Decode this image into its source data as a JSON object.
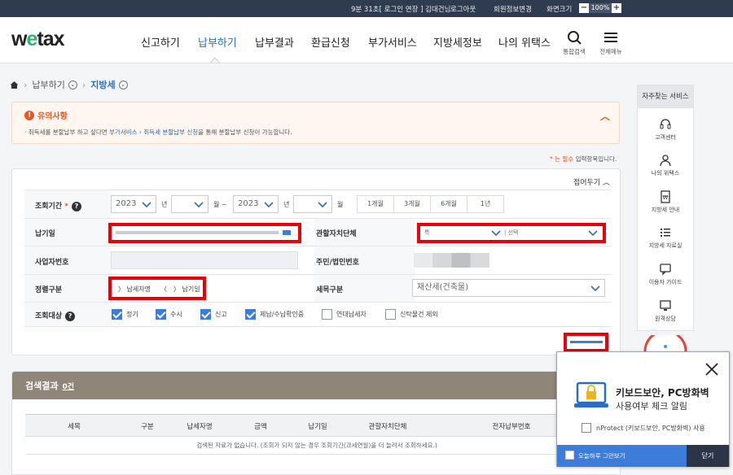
{
  "topbar": {
    "session": "9분 31초[ 로그인 연장 ] 김대건님",
    "logout": "로그아웃",
    "profile": "회원정보변경",
    "zoom_label": "화면크기",
    "zoom_value": "100%",
    "zoom_minus": "−",
    "zoom_plus": "+"
  },
  "header": {
    "logo": "wetax",
    "nav": [
      "신고하기",
      "납부하기",
      "납부결과",
      "환급신청",
      "부가서비스",
      "지방세정보",
      "나의 위택스"
    ],
    "active_nav": "납부하기",
    "search_label": "통합검색",
    "menu_label": "전체메뉴"
  },
  "breadcrumb": {
    "level1": "납부하기",
    "level2": "지방세"
  },
  "notice": {
    "title": "유의사항",
    "text_prefix": "· 취득세를 분할납부 하고 싶다면 ",
    "link": "부가서비스 › 취득세 분할납부 신청",
    "text_suffix": "을 통해 분할납부 신청이 가능합니다."
  },
  "required_note": {
    "prefix": "* 는 ",
    "required": "필수",
    "suffix": " 입력항목입니다."
  },
  "search": {
    "fold_label": "접어두기",
    "period": {
      "label": "조회기간",
      "required_mark": "*",
      "from_year": "2023",
      "from_unit": "년",
      "from_month_unit": "월 ~",
      "to_year": "2023",
      "to_unit": "년",
      "to_month_unit": "월",
      "ranges": [
        "1개월",
        "3개월",
        "6개월",
        "1년"
      ]
    },
    "due_date": {
      "label": "납기일"
    },
    "authority": {
      "label": "관할자치단체",
      "select1": "특",
      "select2": "| 선택"
    },
    "business_no": {
      "label": "사업자번호"
    },
    "resident_no": {
      "label": "주민/법인번호"
    },
    "sort": {
      "label": "정렬구분",
      "opt1": "납세자명",
      "opt2": "납기일"
    },
    "tax_item": {
      "label": "세목구분",
      "value": "재산세(건축물)"
    },
    "target": {
      "label": "조회대상",
      "options": [
        {
          "label": "정기",
          "checked": true
        },
        {
          "label": "수시",
          "checked": true
        },
        {
          "label": "신고",
          "checked": true
        },
        {
          "label": "체납/수납확인중",
          "checked": true
        },
        {
          "label": "연대납세자",
          "checked": false
        },
        {
          "label": "신탁물건 제외",
          "checked": false
        }
      ]
    }
  },
  "result": {
    "title": "검색결과",
    "count": "0건",
    "columns": [
      "세목",
      "구분",
      "납세자명",
      "금액",
      "납기일",
      "관할자치단체",
      "전자납부번호"
    ],
    "empty": "검색된 자료가 없습니다. (조회가 되지 않는 경우 조회기간(과세연월)을 더 늘려서 조회하세요.)"
  },
  "side": {
    "title": "자주찾는 서비스",
    "items": [
      "고객센터",
      "나의 위택스",
      "지방세 안내",
      "지방세 자료실",
      "이용자 가이드",
      "원격상담"
    ]
  },
  "popup": {
    "title1": "키보드보안, PC방화벽",
    "title2": "사용여부 체크 알림",
    "checkbox": "nProtect (키보드보안, PC방화벽) 사용",
    "dont_show": "오늘하루 그만보기",
    "close": "닫기"
  }
}
